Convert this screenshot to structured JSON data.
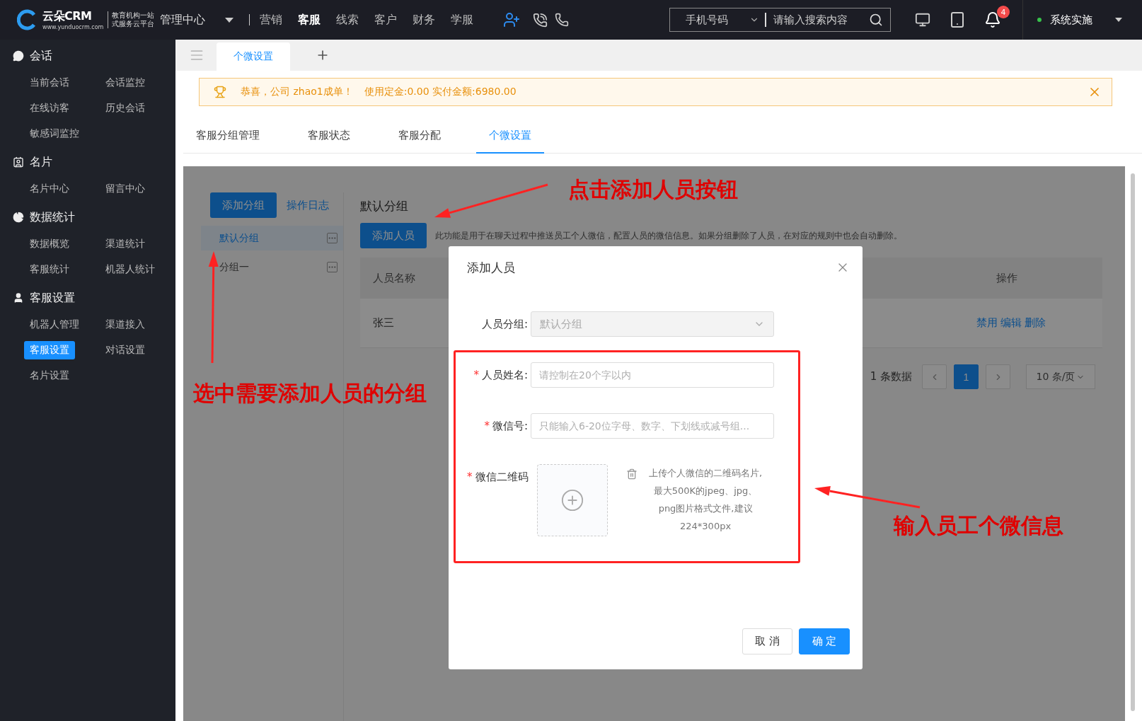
{
  "header": {
    "logo": {
      "name": "云朵CRM",
      "tagline": [
        "教育机构一站",
        "式服务云平台"
      ],
      "url": "www.yunduocrm.com"
    },
    "module_menu": "管理中心",
    "nav": [
      {
        "label": "营销",
        "selected": false
      },
      {
        "label": "客服",
        "selected": true
      },
      {
        "label": "线索",
        "selected": false
      },
      {
        "label": "客户",
        "selected": false
      },
      {
        "label": "财务",
        "selected": false
      },
      {
        "label": "学服",
        "selected": false
      }
    ],
    "search": {
      "type": "手机号码",
      "placeholder": "请输入搜索内容"
    },
    "notifications": "4",
    "user": "系统实施"
  },
  "sidebar": [
    {
      "title": "会话",
      "items": [
        {
          "label": "当前会话",
          "selected": false
        },
        {
          "label": "会话监控",
          "selected": false
        },
        {
          "label": "在线访客",
          "selected": false
        },
        {
          "label": "历史会话",
          "selected": false
        },
        {
          "label": "敏感词监控",
          "selected": false
        }
      ]
    },
    {
      "title": "名片",
      "items": [
        {
          "label": "名片中心",
          "selected": false
        },
        {
          "label": "留言中心",
          "selected": false
        }
      ]
    },
    {
      "title": "数据统计",
      "items": [
        {
          "label": "数据概览",
          "selected": false
        },
        {
          "label": "渠道统计",
          "selected": false
        },
        {
          "label": "客服统计",
          "selected": false
        },
        {
          "label": "机器人统计",
          "selected": false
        }
      ]
    },
    {
      "title": "客服设置",
      "items": [
        {
          "label": "机器人管理",
          "selected": false
        },
        {
          "label": "渠道接入",
          "selected": false
        },
        {
          "label": "客服设置",
          "selected": true
        },
        {
          "label": "对话设置",
          "selected": false
        },
        {
          "label": "名片设置",
          "selected": false
        }
      ]
    }
  ],
  "page_tabs": [
    {
      "label": "个微设置",
      "selected": true
    }
  ],
  "alert": {
    "message": "恭喜，公司 zhao1成单！",
    "detail": "使用定金:0.00 实付金额:6980.00"
  },
  "sub_tabs": [
    {
      "label": "客服分组管理",
      "selected": false
    },
    {
      "label": "客服状态",
      "selected": false
    },
    {
      "label": "客服分配",
      "selected": false
    },
    {
      "label": "个微设置",
      "selected": true
    }
  ],
  "groups": {
    "add_button": "添加分组",
    "log_link": "操作日志",
    "items": [
      {
        "label": "默认分组",
        "selected": true
      },
      {
        "label": "分组一",
        "selected": false
      }
    ]
  },
  "detail": {
    "title": "默认分组",
    "add_button": "添加人员",
    "note": "此功能是用于在聊天过程中推送员工个人微信，配置人员的微信信息。如果分组删除了人员，在对应的规则中也会自动删除。",
    "columns": [
      "人员名称",
      "操作"
    ],
    "rows": [
      {
        "name": "张三",
        "actions": [
          "禁用",
          "编辑",
          "删除"
        ]
      }
    ],
    "pagination": {
      "total": "1 条数据",
      "pages": [
        {
          "label": "1",
          "selected": true
        }
      ],
      "page_size": "10 条/页"
    }
  },
  "dialog": {
    "title": "添加人员",
    "fields": [
      {
        "kind": "select",
        "label": "人员分组:",
        "value": "默认分组",
        "disabled": true
      },
      {
        "kind": "input",
        "label": "人员姓名:",
        "required_mark": "*",
        "placeholder": "请控制在20个字以内"
      },
      {
        "kind": "input",
        "label": "微信号:",
        "required_mark": "*",
        "placeholder": "只能输入6-20位字母、数字、下划线或减号组..."
      },
      {
        "kind": "upload",
        "label": "微信二维码",
        "required_mark": "*",
        "hint": [
          "上传个人微信的二维码名片,",
          "最大500K的jpeg、jpg、",
          "png图片格式文件,建议",
          "224*300px"
        ]
      }
    ],
    "buttons": [
      {
        "label": "取 消",
        "primary": false
      },
      {
        "label": "确 定",
        "primary": true
      }
    ]
  },
  "annotations": [
    "点击添加人员按钮",
    "选中需要添加人员的分组",
    "输入员工个微信息"
  ]
}
